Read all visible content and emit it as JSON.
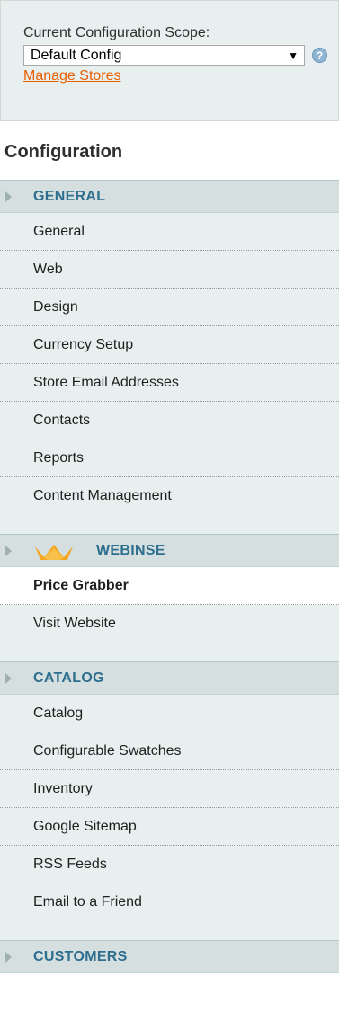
{
  "scope": {
    "label": "Current Configuration Scope:",
    "selected": "Default Config",
    "help_icon": "help-icon",
    "manage_link": "Manage Stores"
  },
  "title": "Configuration",
  "sections": [
    {
      "label": "GENERAL",
      "items": [
        "General",
        "Web",
        "Design",
        "Currency Setup",
        "Store Email Addresses",
        "Contacts",
        "Reports",
        "Content Management"
      ]
    },
    {
      "label": "WEBINSE",
      "icon": "crown-icon",
      "items": [
        "Price Grabber",
        "Visit Website"
      ],
      "active_item": "Price Grabber"
    },
    {
      "label": "CATALOG",
      "items": [
        "Catalog",
        "Configurable Swatches",
        "Inventory",
        "Google Sitemap",
        "RSS Feeds",
        "Email to a Friend"
      ]
    },
    {
      "label": "CUSTOMERS",
      "items": []
    }
  ],
  "colors": {
    "link": "#eb5e00",
    "section_label": "#2e6e8e",
    "panel_bg": "#e7efef",
    "header_bg": "#d5dfdf",
    "crown": "#f5a623"
  }
}
